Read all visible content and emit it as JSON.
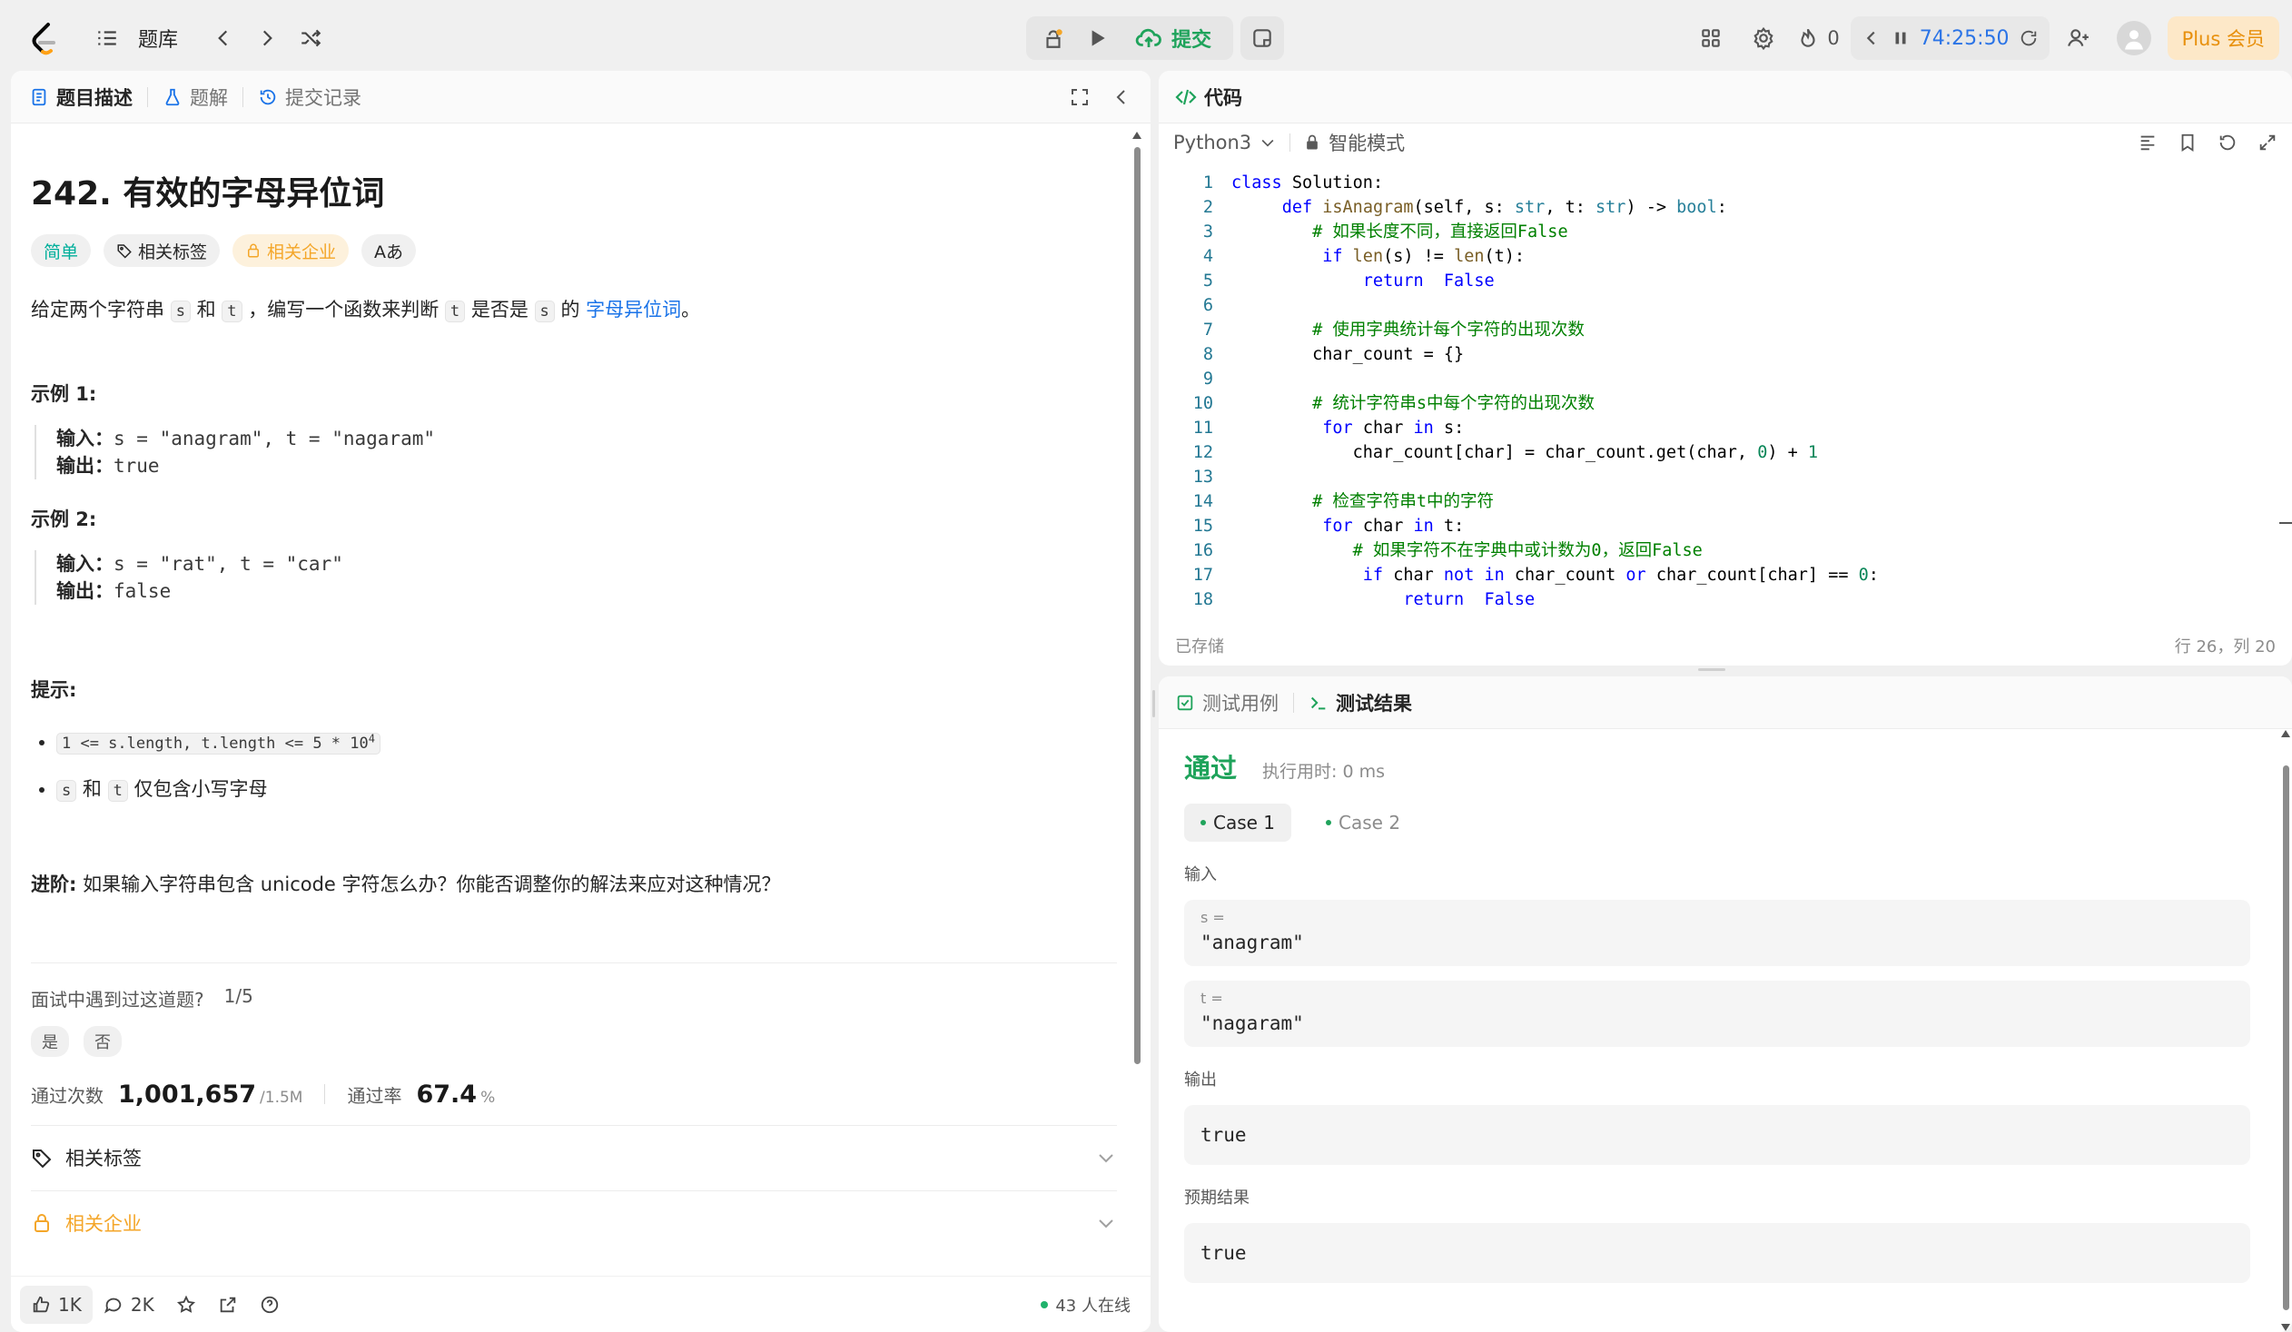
{
  "topbar": {
    "problems_label": "题库",
    "submit_label": "提交",
    "streak_count": "0",
    "timer": "74:25:50",
    "plus_label": "Plus 会员"
  },
  "left": {
    "tabs": [
      "题目描述",
      "题解",
      "提交记录"
    ],
    "title": "242. 有效的字母异位词",
    "chips": {
      "difficulty": "简单",
      "tags": "相关标签",
      "companies": "相关企业",
      "font": "Aあ"
    },
    "desc": {
      "p1": "给定两个字符串 ",
      "s": "s",
      "p2": " 和 ",
      "t": "t",
      "p3": " ，编写一个函数来判断 ",
      "p4": " 是否是 ",
      "p5": " 的 ",
      "link": "字母异位词",
      "p6": "。"
    },
    "examples": [
      {
        "heading": "示例 1:",
        "input_label": "输入：",
        "input": "s = \"anagram\", t = \"nagaram\"",
        "output_label": "输出：",
        "output": "true"
      },
      {
        "heading": "示例 2:",
        "input_label": "输入：",
        "input": "s = \"rat\", t = \"car\"",
        "output_label": "输出：",
        "output": "false"
      }
    ],
    "hints_heading": "提示:",
    "constraint1": "1 <= s.length, t.length <= 5 * 10",
    "constraint1_exp": "4",
    "constraint2_a": "s",
    "constraint2_and": " 和 ",
    "constraint2_b": "t",
    "constraint2_rest": " 仅包含小写字母",
    "advance_label": "进阶:",
    "advance_text": " 如果输入字符串包含 unicode 字符怎么办？你能否调整你的解法来应对这种情况？",
    "interview_q": "面试中遇到过这道题?",
    "interview_ratio": "1/5",
    "yes": "是",
    "no": "否",
    "stats": {
      "accepted_label": "通过次数",
      "accepted": "1,001,657",
      "total": "/1.5M",
      "rate_label": "通过率",
      "rate": "67.4",
      "rate_unit": "%"
    },
    "related_tags": "相关标签",
    "related_companies": "相关企业",
    "footer": {
      "likes": "1K",
      "comments": "2K",
      "online": "43 人在线"
    }
  },
  "code": {
    "tab_label": "代码",
    "language": "Python3",
    "mode": "智能模式",
    "saved": "已存储",
    "cursor": "行 26，列 20",
    "lines": [
      [
        [
          "kw",
          "class"
        ],
        [
          "",
          "Solution:"
        ]
      ],
      [
        [
          "",
          "    "
        ],
        [
          "kw",
          "def"
        ],
        [
          "",
          ""
        ],
        [
          "fn",
          "isAnagram"
        ],
        [
          "",
          "(self, s: "
        ],
        [
          "bi",
          "str"
        ],
        [
          "",
          ", t: "
        ],
        [
          "bi",
          "str"
        ],
        [
          "",
          ") -> "
        ],
        [
          "bi",
          "bool"
        ],
        [
          "",
          ":"
        ]
      ],
      [
        [
          "",
          "        "
        ],
        [
          "cm",
          "# 如果长度不同，直接返回False"
        ]
      ],
      [
        [
          "",
          "        "
        ],
        [
          "kw",
          "if"
        ],
        [
          "",
          ""
        ],
        [
          "fn",
          "len"
        ],
        [
          "",
          "(s) != "
        ],
        [
          "fn",
          "len"
        ],
        [
          "",
          "(t):"
        ]
      ],
      [
        [
          "",
          "            "
        ],
        [
          "kw",
          "return"
        ],
        [
          "",
          ""
        ],
        [
          "kw",
          "False"
        ]
      ],
      [
        [
          "",
          ""
        ]
      ],
      [
        [
          "",
          "        "
        ],
        [
          "cm",
          "# 使用字典统计每个字符的出现次数"
        ]
      ],
      [
        [
          "",
          "        char_count = {}"
        ]
      ],
      [
        [
          "",
          ""
        ]
      ],
      [
        [
          "",
          "        "
        ],
        [
          "cm",
          "# 统计字符串s中每个字符的出现次数"
        ]
      ],
      [
        [
          "",
          "        "
        ],
        [
          "kw",
          "for"
        ],
        [
          "",
          "char"
        ],
        [
          "kw",
          "in"
        ],
        [
          "",
          "s:"
        ]
      ],
      [
        [
          "",
          "            char_count[char] = char_count.get(char, "
        ],
        [
          "nm",
          "0"
        ],
        [
          "",
          ") + "
        ],
        [
          "nm",
          "1"
        ]
      ],
      [
        [
          "",
          ""
        ]
      ],
      [
        [
          "",
          "        "
        ],
        [
          "cm",
          "# 检查字符串t中的字符"
        ]
      ],
      [
        [
          "",
          "        "
        ],
        [
          "kw",
          "for"
        ],
        [
          "",
          "char"
        ],
        [
          "kw",
          "in"
        ],
        [
          "",
          "t:"
        ]
      ],
      [
        [
          "",
          "            "
        ],
        [
          "cm",
          "# 如果字符不在字典中或计数为0，返回False"
        ]
      ],
      [
        [
          "",
          "            "
        ],
        [
          "kw",
          "if"
        ],
        [
          "",
          "char"
        ],
        [
          "kw",
          "not in"
        ],
        [
          "",
          "char_count"
        ],
        [
          "kw",
          "or"
        ],
        [
          "",
          "char_count[char] == "
        ],
        [
          "nm",
          "0"
        ],
        [
          "",
          ":"
        ]
      ],
      [
        [
          "",
          "                "
        ],
        [
          "kw",
          "return"
        ],
        [
          "",
          ""
        ],
        [
          "kw",
          "False"
        ]
      ]
    ]
  },
  "test": {
    "tab_cases": "测试用例",
    "tab_result": "测试结果",
    "status": "通过",
    "runtime": "执行用时: 0 ms",
    "cases": [
      "Case 1",
      "Case 2"
    ],
    "input_label": "输入",
    "var_s_name": "s =",
    "var_s_value": "\"anagram\"",
    "var_t_name": "t =",
    "var_t_value": "\"nagaram\"",
    "output_label": "输出",
    "output": "true",
    "expected_label": "预期结果",
    "expected": "true"
  },
  "colors": {
    "accent_green": "#1fa35b",
    "easy_teal": "#00af9b",
    "company_orange": "#f4a629",
    "link_blue": "#1a73e8",
    "timer_blue": "#2b74e6"
  }
}
